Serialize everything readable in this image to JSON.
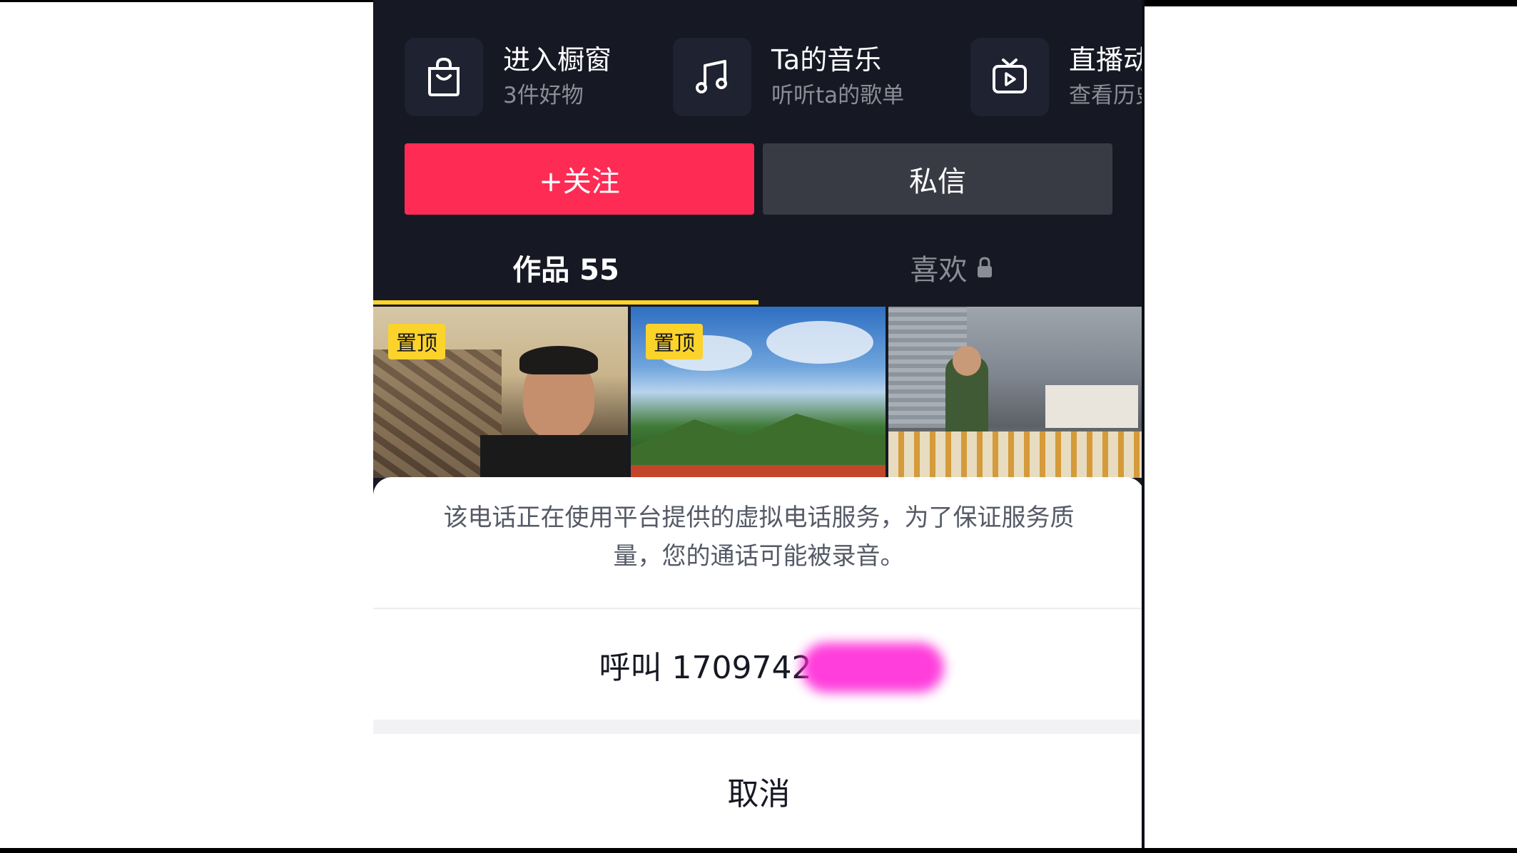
{
  "shortcuts": [
    {
      "title": "进入橱窗",
      "subtitle": "3件好物",
      "icon": "shopping-bag-icon"
    },
    {
      "title": "Ta的音乐",
      "subtitle": "听听ta的歌单",
      "icon": "music-note-icon"
    },
    {
      "title": "直播动",
      "subtitle": "查看历史",
      "icon": "live-tv-icon"
    }
  ],
  "actions": {
    "follow_label": "+关注",
    "message_label": "私信"
  },
  "tabs": {
    "works_label": "作品 55",
    "likes_label": "喜欢"
  },
  "grid": {
    "pinned_label": "置顶"
  },
  "sheet": {
    "notice": "该电话正在使用平台提供的虚拟电话服务，为了保证服务质量，您的通话可能被录音。",
    "call_label": "呼叫 1709742",
    "cancel_label": "取消"
  },
  "colors": {
    "accent": "#fe2c55",
    "tab_indicator": "#fcd32b",
    "background": "#161823"
  }
}
